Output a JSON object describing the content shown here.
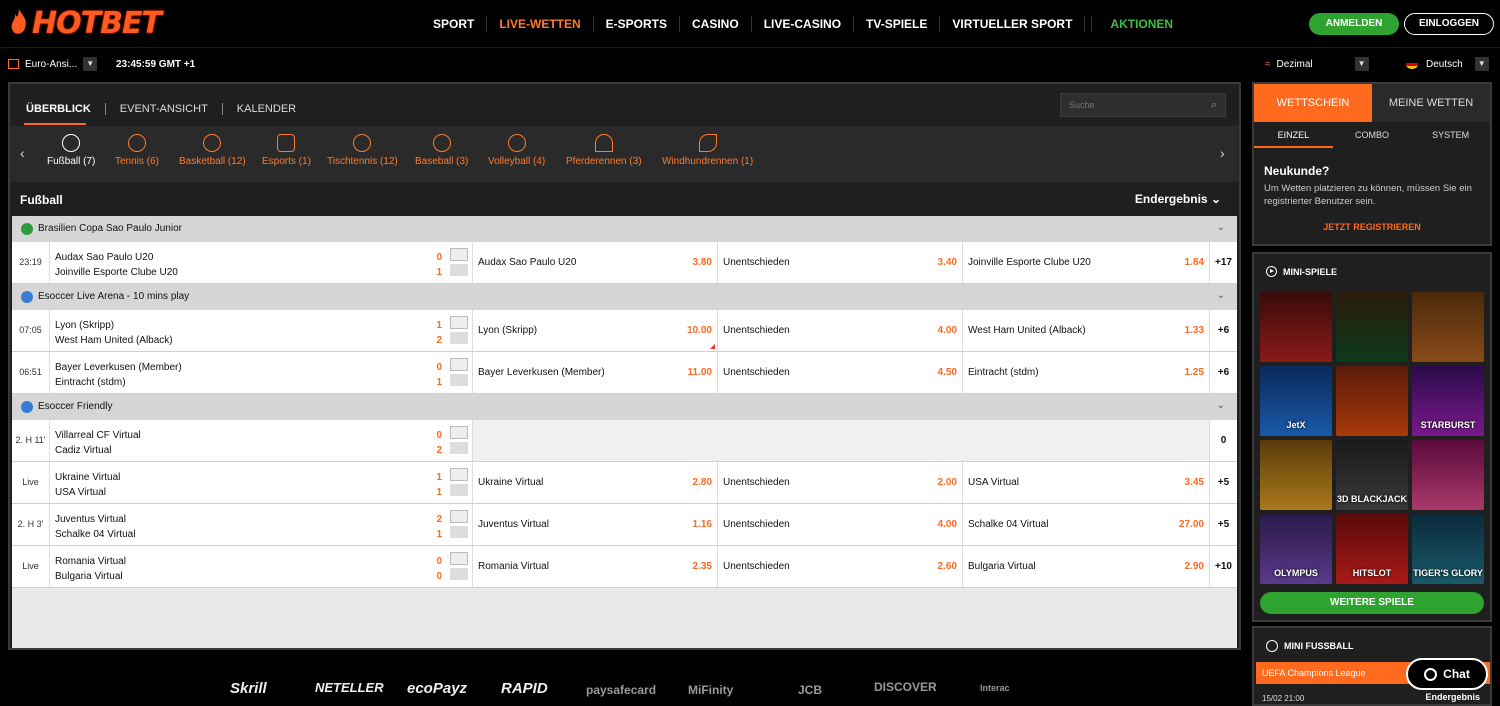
{
  "brand": {
    "logo_text": "HOTBET"
  },
  "nav": {
    "items": [
      "SPORT",
      "LIVE-WETTEN",
      "E-SPORTS",
      "CASINO",
      "LIVE-CASINO",
      "TV-SPIELE",
      "VIRTUELLER SPORT"
    ],
    "promo": "AKTIONEN",
    "active_item": "LIVE-WETTEN"
  },
  "auth": {
    "login": "ANMELDEN",
    "register": "EINLOGGEN"
  },
  "subbar": {
    "view": "Euro-Ansi...",
    "clock": "23:45:59 GMT +1",
    "odds_format": "Dezimal",
    "language": "Deutsch"
  },
  "tabs": [
    "ÜBERBLICK",
    "EVENT-ANSICHT",
    "KALENDER"
  ],
  "search": {
    "placeholder": "Suche"
  },
  "sports": [
    "Fußball (7)",
    "Tennis (6)",
    "Basketball (12)",
    "Esports (1)",
    "Tischtennis (12)",
    "Baseball (3)",
    "Volleyball (4)",
    "Pferderennen (3)",
    "Windhundrennen (1)"
  ],
  "section": {
    "title": "Fußball",
    "market": "Endergebnis"
  },
  "leagues": [
    {
      "name": "Brasilien Copa Sao Paulo Junior",
      "icon_color": "#2a9d3a"
    },
    {
      "name": "Esoccer Live Arena - 10 mins play",
      "icon_color": "#3a7bd5"
    },
    {
      "name": "Esoccer Friendly",
      "icon_color": "#3a7bd5"
    }
  ],
  "matches": [
    {
      "time": "23:19",
      "home": "Audax Sao Paulo U20",
      "away": "Joinville Esporte Clube U20",
      "score_home": "0",
      "score_away": "1",
      "o1_label": "Audax Sao Paulo U20",
      "o1": "3.80",
      "ox_label": "Unentschieden",
      "ox": "3.40",
      "o2_label": "Joinville Esporte Clube U20",
      "o2": "1.84",
      "more": "+17"
    },
    {
      "time": "07:05",
      "home": "Lyon (Skripp)",
      "away": "West Ham United (Alback)",
      "score_home": "1",
      "score_away": "2",
      "o1_label": "Lyon (Skripp)",
      "o1": "10.00",
      "ox_label": "Unentschieden",
      "ox": "4.00",
      "o2_label": "West Ham United (Alback)",
      "o2": "1.33",
      "more": "+6"
    },
    {
      "time": "06:51",
      "home": "Bayer Leverkusen (Member)",
      "away": "Eintracht (stdm)",
      "score_home": "0",
      "score_away": "1",
      "o1_label": "Bayer Leverkusen (Member)",
      "o1": "11.00",
      "ox_label": "Unentschieden",
      "ox": "4.50",
      "o2_label": "Eintracht (stdm)",
      "o2": "1.25",
      "more": "+6"
    },
    {
      "time": "2. H 11'",
      "home": "Villarreal CF Virtual",
      "away": "Cadiz Virtual",
      "score_home": "0",
      "score_away": "2",
      "more": "0"
    },
    {
      "time": "Live",
      "home": "Ukraine Virtual",
      "away": "USA Virtual",
      "score_home": "1",
      "score_away": "1",
      "o1_label": "Ukraine Virtual",
      "o1": "2.80",
      "ox_label": "Unentschieden",
      "ox": "2.00",
      "o2_label": "USA Virtual",
      "o2": "3.45",
      "more": "+5"
    },
    {
      "time": "2. H 3'",
      "home": "Juventus Virtual",
      "away": "Schalke 04 Virtual",
      "score_home": "2",
      "score_away": "1",
      "o1_label": "Juventus Virtual",
      "o1": "1.16",
      "ox_label": "Unentschieden",
      "ox": "4.00",
      "o2_label": "Schalke 04 Virtual",
      "o2": "27.00",
      "more": "+5"
    },
    {
      "time": "Live",
      "home": "Romania Virtual",
      "away": "Bulgaria Virtual",
      "score_home": "0",
      "score_away": "0",
      "o1_label": "Romania Virtual",
      "o1": "2.35",
      "ox_label": "Unentschieden",
      "ox": "2.60",
      "o2_label": "Bulgaria Virtual",
      "o2": "2.90",
      "more": "+10"
    }
  ],
  "betslip": {
    "tabs": [
      "WETTSCHEIN",
      "MEINE WETTEN"
    ],
    "subtabs": [
      "EINZEL",
      "COMBO",
      "SYSTEM"
    ],
    "heading": "Neukunde?",
    "text": "Um Wetten platzieren zu können, müssen Sie ein registrierter Benutzer sein.",
    "cta": "JETZT REGISTRIEREN"
  },
  "minigames": {
    "title": "MINI-SPIELE",
    "games": [
      "",
      "",
      "",
      "JetX",
      "",
      "STARBURST",
      "",
      "3D BLACKJACK",
      "",
      "OLYMPUS",
      "HITSLOT",
      "TIGER'S GLORY"
    ],
    "more": "WEITERE SPIELE"
  },
  "minifootball": {
    "title": "MINI FUSSBALL",
    "league": "UEFA Champions League",
    "date": "15/02 21:00",
    "market": "Endergebnis"
  },
  "chat": {
    "label": "Chat"
  },
  "payments": [
    "Skrill",
    "NETELLER",
    "ecoPayz",
    "RAPID",
    "paysafecard",
    "MiFinity",
    "JCB",
    "DISCOVER",
    "Interac"
  ],
  "colors": {
    "accent": "#ff6a1f",
    "green": "#2fa32f",
    "bg": "#000000"
  }
}
